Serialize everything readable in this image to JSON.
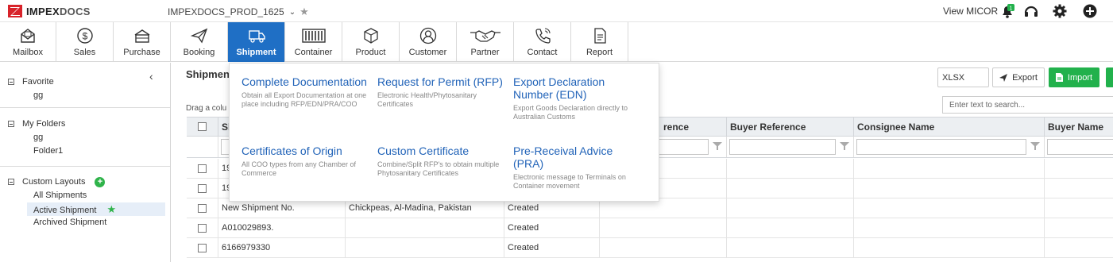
{
  "app": {
    "logo_text_1": "IMPEX",
    "logo_text_2": "DOCS",
    "instance_name": "IMPEXDOCS_PROD_1625",
    "view_user": "View MICOR",
    "notification_count": "1",
    "brand_red": "#d8232a",
    "accent_blue": "#1f6fc5",
    "accent_green": "#22b14c"
  },
  "modules": [
    {
      "label": "Mailbox",
      "icon": "mailbox-icon"
    },
    {
      "label": "Sales",
      "icon": "dollar-icon"
    },
    {
      "label": "Purchase",
      "icon": "purchase-icon"
    },
    {
      "label": "Booking",
      "icon": "paper-plane-icon"
    },
    {
      "label": "Shipment",
      "icon": "truck-icon"
    },
    {
      "label": "Container",
      "icon": "container-icon"
    },
    {
      "label": "Product",
      "icon": "box-icon"
    },
    {
      "label": "Customer",
      "icon": "user-icon"
    },
    {
      "label": "Partner",
      "icon": "handshake-icon"
    },
    {
      "label": "Contact",
      "icon": "phone-icon"
    },
    {
      "label": "Report",
      "icon": "document-icon"
    }
  ],
  "sidebar": {
    "favorite": {
      "title": "Favorite",
      "items": [
        "gg"
      ]
    },
    "my_folders": {
      "title": "My Folders",
      "items": [
        "gg",
        "Folder1"
      ]
    },
    "custom_layouts": {
      "title": "Custom Layouts",
      "items": [
        "All Shipments",
        "Active Shipment",
        "Archived Shipment"
      ]
    }
  },
  "main": {
    "title": "Shipmen",
    "drag_hint": "Drag a colu",
    "export_format": "XLSX",
    "export_label": "Export",
    "import_label": "Import",
    "search_placeholder": "Enter text to search..."
  },
  "grid": {
    "columns": [
      "Sh",
      "",
      "",
      "rence",
      "Buyer Reference",
      "Consignee Name",
      "Buyer Name"
    ],
    "rows": [
      [
        "19",
        "",
        "",
        "",
        "",
        "",
        ""
      ],
      [
        "19",
        "",
        "",
        "",
        "",
        "",
        ""
      ],
      [
        "New Shipment No.",
        "Chickpeas, Al-Madina, Pakistan",
        "Created",
        "",
        "",
        "",
        ""
      ],
      [
        "A010029893.",
        "",
        "Created",
        "",
        "",
        "",
        ""
      ],
      [
        "6166979330",
        "",
        "Created",
        "",
        "",
        "",
        ""
      ]
    ]
  },
  "mega_menu": [
    {
      "title": "Complete Documentation",
      "desc": "Obtain all Export Documentation at one place including RFP/EDN/PRA/COO"
    },
    {
      "title": "Request for Permit (RFP)",
      "desc": "Electronic Health/Phytosanitary Certificates"
    },
    {
      "title": "Export Declaration Number (EDN)",
      "desc": "Export Goods Declaration directly to Australian Customs"
    },
    {
      "title": "Certificates of Origin",
      "desc": "All COO types from any Chamber of Commerce"
    },
    {
      "title": "Custom Certificate",
      "desc": "Combine/Split RFP's to obtain multiple Phytosanitary Certificates"
    },
    {
      "title": "Pre-Receival Advice (PRA)",
      "desc": "Electronic message to Terminals on Container movement"
    }
  ]
}
